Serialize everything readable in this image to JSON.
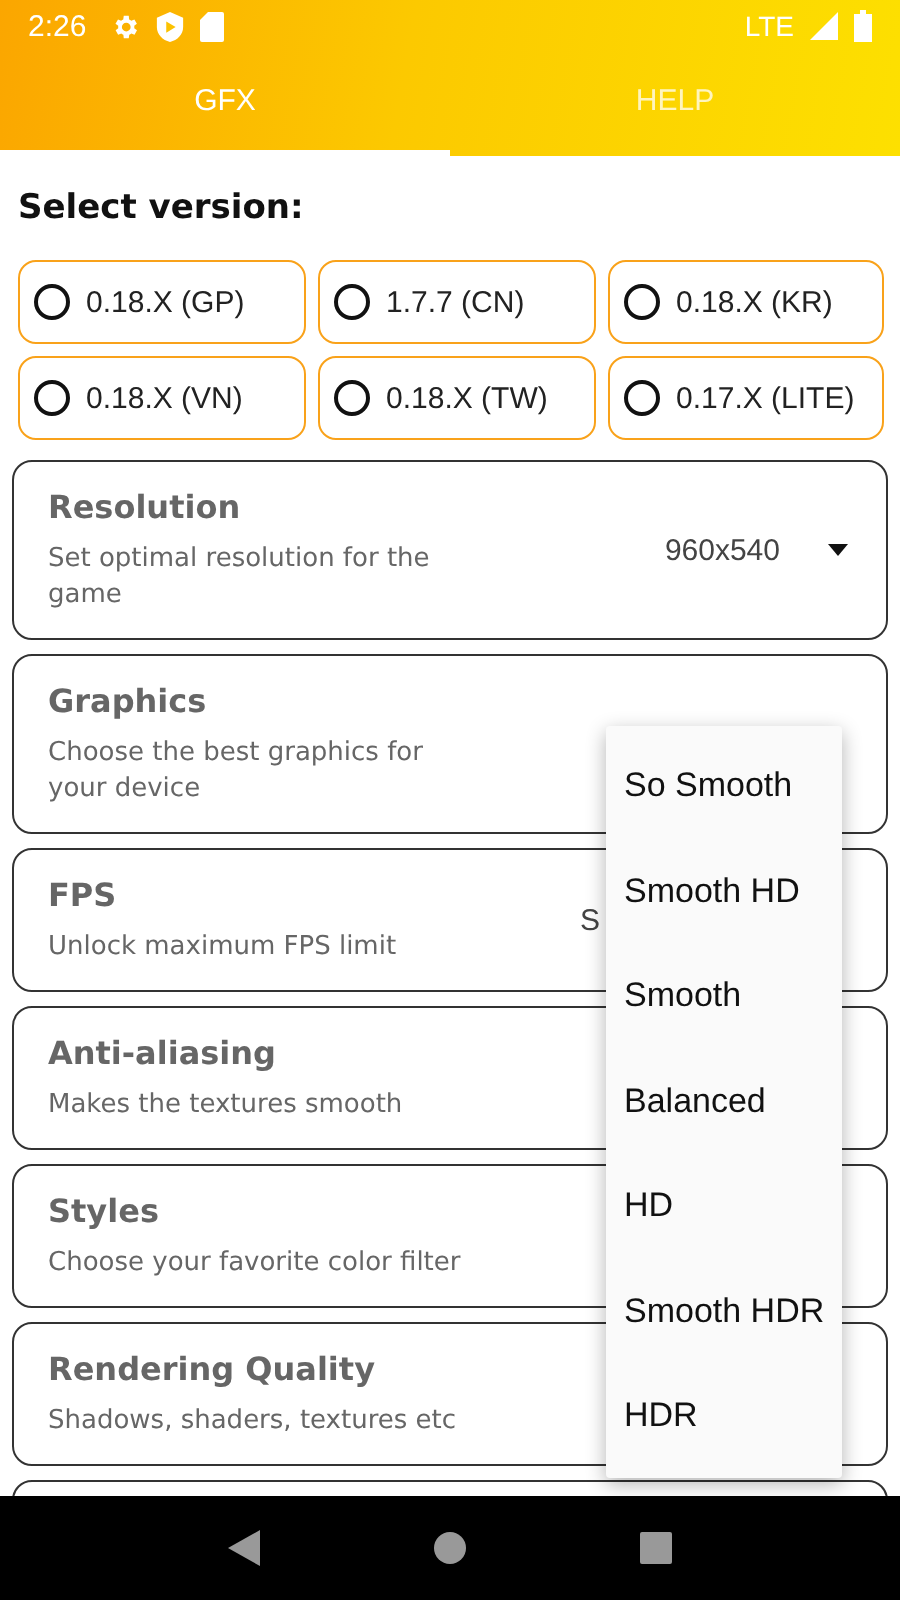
{
  "status_bar": {
    "time": "2:26",
    "network": "LTE"
  },
  "tabs": [
    {
      "label": "GFX",
      "selected": true
    },
    {
      "label": "HELP",
      "selected": false
    }
  ],
  "heading": "Select version:",
  "versions": [
    {
      "label": "0.18.X (GP)",
      "selected": false
    },
    {
      "label": "1.7.7 (CN)",
      "selected": false
    },
    {
      "label": "0.18.X (KR)",
      "selected": false
    },
    {
      "label": "0.18.X (VN)",
      "selected": false
    },
    {
      "label": "0.18.X (TW)",
      "selected": false
    },
    {
      "label": "0.17.X (LITE)",
      "selected": false
    }
  ],
  "settings": [
    {
      "title": "Resolution",
      "description": "Set optimal resolution for the game",
      "value": "960x540"
    },
    {
      "title": "Graphics",
      "description": "Choose the best graphics for your device"
    },
    {
      "title": "FPS",
      "description": "Unlock maximum FPS limit",
      "value": "S"
    },
    {
      "title": "Anti-aliasing",
      "description": "Makes the textures smooth"
    },
    {
      "title": "Styles",
      "description": "Choose your favorite color filter"
    },
    {
      "title": "Rendering Quality",
      "description": "Shadows, shaders, textures etc"
    }
  ],
  "dropdown_menu": {
    "options": [
      "So Smooth",
      "Smooth HD",
      "Smooth",
      "Balanced",
      "HD",
      "Smooth HDR",
      "HDR"
    ]
  }
}
